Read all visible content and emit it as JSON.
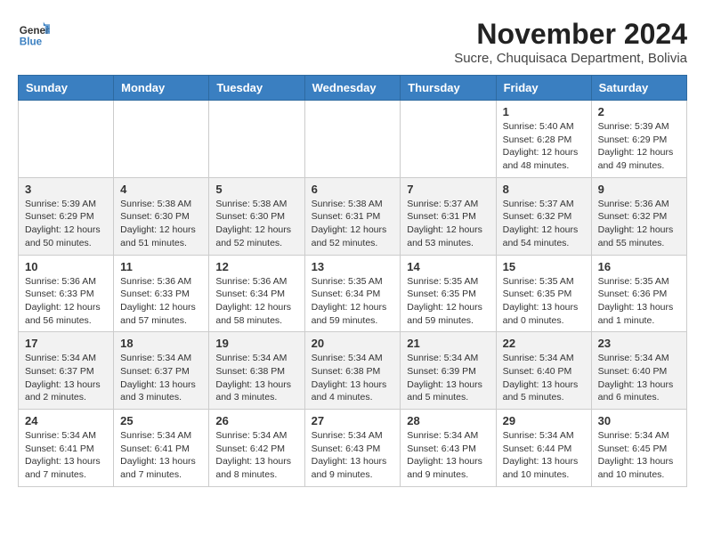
{
  "logo": {
    "line1": "General",
    "line2": "Blue"
  },
  "title": "November 2024",
  "location": "Sucre, Chuquisaca Department, Bolivia",
  "weekdays": [
    "Sunday",
    "Monday",
    "Tuesday",
    "Wednesday",
    "Thursday",
    "Friday",
    "Saturday"
  ],
  "weeks": [
    [
      {
        "day": "",
        "info": ""
      },
      {
        "day": "",
        "info": ""
      },
      {
        "day": "",
        "info": ""
      },
      {
        "day": "",
        "info": ""
      },
      {
        "day": "",
        "info": ""
      },
      {
        "day": "1",
        "info": "Sunrise: 5:40 AM\nSunset: 6:28 PM\nDaylight: 12 hours and 48 minutes."
      },
      {
        "day": "2",
        "info": "Sunrise: 5:39 AM\nSunset: 6:29 PM\nDaylight: 12 hours and 49 minutes."
      }
    ],
    [
      {
        "day": "3",
        "info": "Sunrise: 5:39 AM\nSunset: 6:29 PM\nDaylight: 12 hours and 50 minutes."
      },
      {
        "day": "4",
        "info": "Sunrise: 5:38 AM\nSunset: 6:30 PM\nDaylight: 12 hours and 51 minutes."
      },
      {
        "day": "5",
        "info": "Sunrise: 5:38 AM\nSunset: 6:30 PM\nDaylight: 12 hours and 52 minutes."
      },
      {
        "day": "6",
        "info": "Sunrise: 5:38 AM\nSunset: 6:31 PM\nDaylight: 12 hours and 52 minutes."
      },
      {
        "day": "7",
        "info": "Sunrise: 5:37 AM\nSunset: 6:31 PM\nDaylight: 12 hours and 53 minutes."
      },
      {
        "day": "8",
        "info": "Sunrise: 5:37 AM\nSunset: 6:32 PM\nDaylight: 12 hours and 54 minutes."
      },
      {
        "day": "9",
        "info": "Sunrise: 5:36 AM\nSunset: 6:32 PM\nDaylight: 12 hours and 55 minutes."
      }
    ],
    [
      {
        "day": "10",
        "info": "Sunrise: 5:36 AM\nSunset: 6:33 PM\nDaylight: 12 hours and 56 minutes."
      },
      {
        "day": "11",
        "info": "Sunrise: 5:36 AM\nSunset: 6:33 PM\nDaylight: 12 hours and 57 minutes."
      },
      {
        "day": "12",
        "info": "Sunrise: 5:36 AM\nSunset: 6:34 PM\nDaylight: 12 hours and 58 minutes."
      },
      {
        "day": "13",
        "info": "Sunrise: 5:35 AM\nSunset: 6:34 PM\nDaylight: 12 hours and 59 minutes."
      },
      {
        "day": "14",
        "info": "Sunrise: 5:35 AM\nSunset: 6:35 PM\nDaylight: 12 hours and 59 minutes."
      },
      {
        "day": "15",
        "info": "Sunrise: 5:35 AM\nSunset: 6:35 PM\nDaylight: 13 hours and 0 minutes."
      },
      {
        "day": "16",
        "info": "Sunrise: 5:35 AM\nSunset: 6:36 PM\nDaylight: 13 hours and 1 minute."
      }
    ],
    [
      {
        "day": "17",
        "info": "Sunrise: 5:34 AM\nSunset: 6:37 PM\nDaylight: 13 hours and 2 minutes."
      },
      {
        "day": "18",
        "info": "Sunrise: 5:34 AM\nSunset: 6:37 PM\nDaylight: 13 hours and 3 minutes."
      },
      {
        "day": "19",
        "info": "Sunrise: 5:34 AM\nSunset: 6:38 PM\nDaylight: 13 hours and 3 minutes."
      },
      {
        "day": "20",
        "info": "Sunrise: 5:34 AM\nSunset: 6:38 PM\nDaylight: 13 hours and 4 minutes."
      },
      {
        "day": "21",
        "info": "Sunrise: 5:34 AM\nSunset: 6:39 PM\nDaylight: 13 hours and 5 minutes."
      },
      {
        "day": "22",
        "info": "Sunrise: 5:34 AM\nSunset: 6:40 PM\nDaylight: 13 hours and 5 minutes."
      },
      {
        "day": "23",
        "info": "Sunrise: 5:34 AM\nSunset: 6:40 PM\nDaylight: 13 hours and 6 minutes."
      }
    ],
    [
      {
        "day": "24",
        "info": "Sunrise: 5:34 AM\nSunset: 6:41 PM\nDaylight: 13 hours and 7 minutes."
      },
      {
        "day": "25",
        "info": "Sunrise: 5:34 AM\nSunset: 6:41 PM\nDaylight: 13 hours and 7 minutes."
      },
      {
        "day": "26",
        "info": "Sunrise: 5:34 AM\nSunset: 6:42 PM\nDaylight: 13 hours and 8 minutes."
      },
      {
        "day": "27",
        "info": "Sunrise: 5:34 AM\nSunset: 6:43 PM\nDaylight: 13 hours and 9 minutes."
      },
      {
        "day": "28",
        "info": "Sunrise: 5:34 AM\nSunset: 6:43 PM\nDaylight: 13 hours and 9 minutes."
      },
      {
        "day": "29",
        "info": "Sunrise: 5:34 AM\nSunset: 6:44 PM\nDaylight: 13 hours and 10 minutes."
      },
      {
        "day": "30",
        "info": "Sunrise: 5:34 AM\nSunset: 6:45 PM\nDaylight: 13 hours and 10 minutes."
      }
    ]
  ]
}
